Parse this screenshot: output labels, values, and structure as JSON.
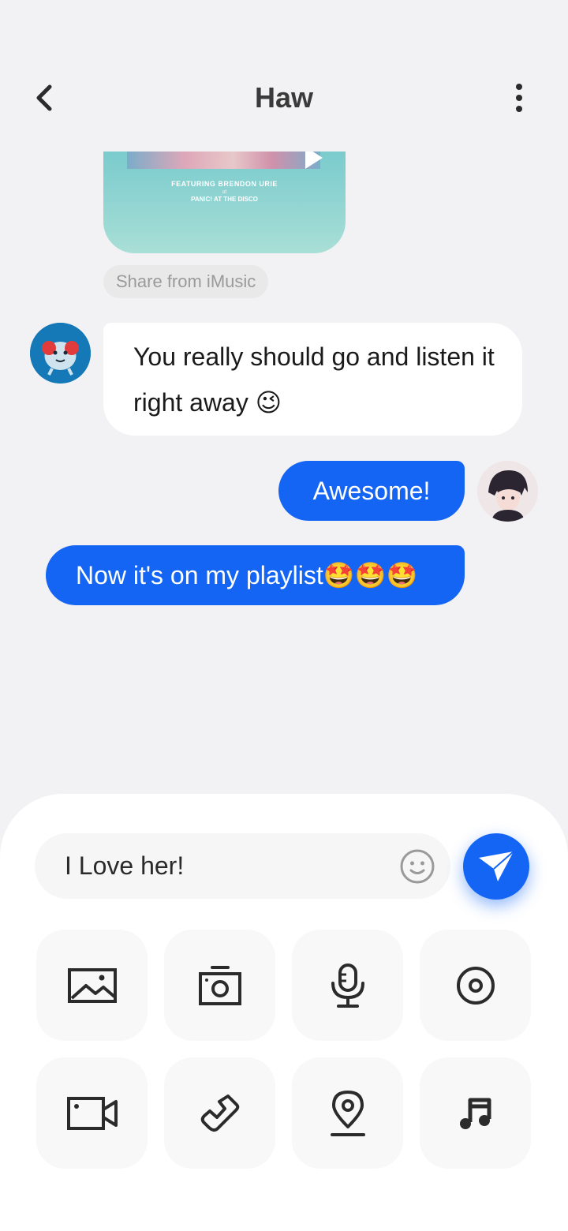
{
  "header": {
    "title": "Haw",
    "back_icon": "chevron-left-icon",
    "more_icon": "more-vertical-icon"
  },
  "messages": {
    "media_card": {
      "caption_line1": "FEATURING BRENDON URIE",
      "caption_line2": "of",
      "caption_line3": "PANIC! AT THE DISCO"
    },
    "share_label": "Share from iMusic",
    "incoming_text": "You really should go and listen it right away 😉",
    "outgoing_1": "Awesome!",
    "outgoing_2": "Now it's on my playlist🤩🤩🤩"
  },
  "composer": {
    "input_value": "I Love her!",
    "emoji_icon": "smiley-icon",
    "send_icon": "paper-plane-icon"
  },
  "attachments": [
    {
      "name": "image-icon"
    },
    {
      "name": "camera-icon"
    },
    {
      "name": "microphone-icon"
    },
    {
      "name": "record-icon"
    },
    {
      "name": "video-icon"
    },
    {
      "name": "phone-icon"
    },
    {
      "name": "location-icon"
    },
    {
      "name": "music-icon"
    }
  ],
  "colors": {
    "accent": "#1565f5",
    "background": "#f2f2f4",
    "bubble_incoming": "#ffffff",
    "icon": "#2b2b2b"
  }
}
